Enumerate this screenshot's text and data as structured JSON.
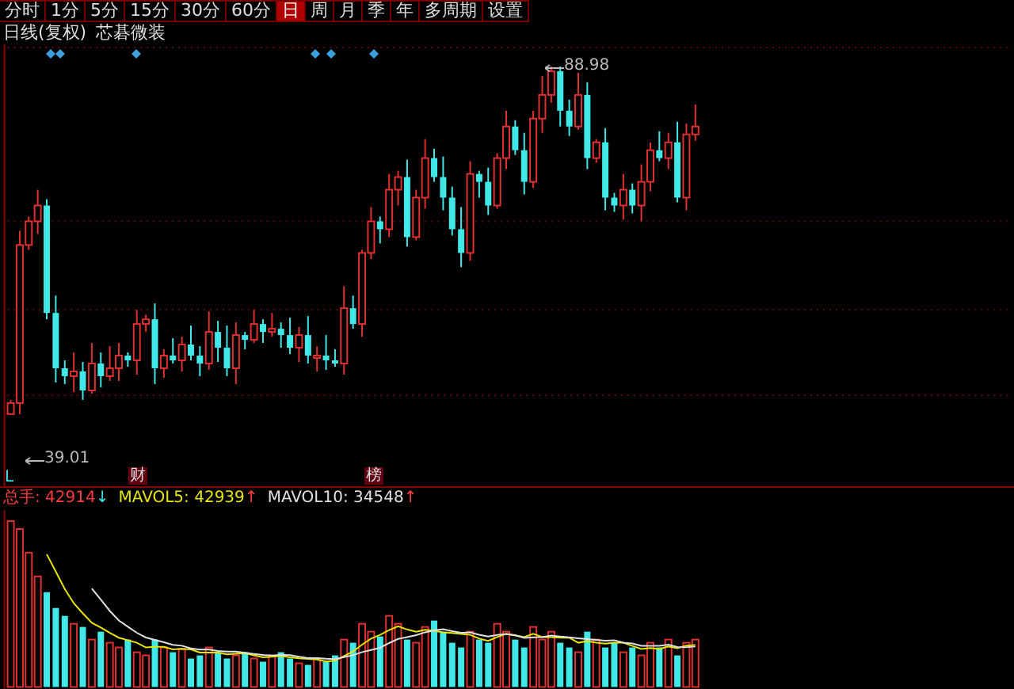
{
  "tabs": [
    {
      "label": "分时",
      "selected": false
    },
    {
      "label": "1分",
      "selected": false
    },
    {
      "label": "5分",
      "selected": false
    },
    {
      "label": "15分",
      "selected": false
    },
    {
      "label": "30分",
      "selected": false
    },
    {
      "label": "60分",
      "selected": false
    },
    {
      "label": "日",
      "selected": true
    },
    {
      "label": "周",
      "selected": false
    },
    {
      "label": "月",
      "selected": false
    },
    {
      "label": "季",
      "selected": false
    },
    {
      "label": "年",
      "selected": false
    },
    {
      "label": "多周期",
      "selected": false
    },
    {
      "label": "设置",
      "selected": false
    }
  ],
  "chart_title": "日线(复权)",
  "stock_name": "芯碁微装",
  "price_chart": {
    "high_label": "88.98",
    "low_label": "39.01",
    "low_marker": "L",
    "event_badges": [
      {
        "label": "财"
      },
      {
        "label": "榜"
      }
    ]
  },
  "volume_legend": [
    {
      "kind": "value",
      "text": "总手: 42914",
      "color": "#ff3c3c"
    },
    {
      "kind": "arrow",
      "text": "↓",
      "color": "#3ce6e6"
    },
    {
      "kind": "value",
      "text": "MAVOL5: 42939",
      "color": "#e6e600"
    },
    {
      "kind": "arrow",
      "text": "↑",
      "color": "#ff3c3c"
    },
    {
      "kind": "value",
      "text": "MAVOL10: 34548",
      "color": "#e0e0e0"
    },
    {
      "kind": "arrow",
      "text": "↑",
      "color": "#ff3c3c"
    }
  ]
}
